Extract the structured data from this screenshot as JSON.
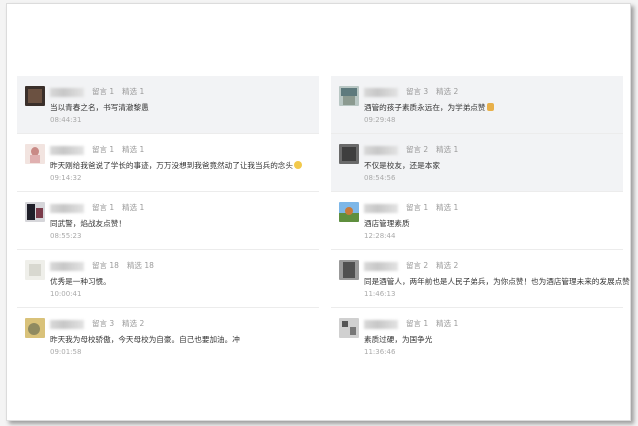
{
  "left": [
    {
      "likes": "留言 1",
      "picks": "精选 1",
      "text": "当以青春之名，书写清澈黎愚",
      "time": "08:44:31",
      "emoji": ""
    },
    {
      "likes": "留言 1",
      "picks": "精选 1",
      "text": "昨天刚给我爸说了学长的事迹，万万没想到我爸竟然动了让我当兵的念头",
      "time": "09:14:32",
      "emoji": "grin-emoji"
    },
    {
      "likes": "留言 1",
      "picks": "精选 1",
      "text": "同武警，焰战友点赞！",
      "time": "08:55:23",
      "emoji": ""
    },
    {
      "likes": "留言 18",
      "picks": "精选 18",
      "text": "优秀是一种习惯。",
      "time": "10:00:41",
      "emoji": ""
    },
    {
      "likes": "留言 3",
      "picks": "精选 2",
      "text": "昨天我为母校骄傲，今天母校为自豪。自己也要加油。冲",
      "time": "09:01:58",
      "emoji": ""
    }
  ],
  "right": [
    {
      "likes": "留言 3",
      "picks": "精选 2",
      "text": "酒管的孩子素质永远在，为学弟点赞",
      "time": "09:29:48",
      "emoji": "thumbs-up-emoji"
    },
    {
      "likes": "留言 2",
      "picks": "精选 1",
      "text": "不仅是校友，还是本家",
      "time": "08:54:56",
      "emoji": ""
    },
    {
      "likes": "留言 1",
      "picks": "精选 1",
      "text": "酒店管理素质",
      "time": "12:28:44",
      "emoji": ""
    },
    {
      "likes": "留言 2",
      "picks": "精选 2",
      "text": "同是酒管人，两年前也是人民子弟兵，为你点赞！也为酒店管理未来的发展点赞！",
      "time": "11:46:13",
      "emoji": "thumbs-up-emoji"
    },
    {
      "likes": "留言 1",
      "picks": "精选 1",
      "text": "素质过硬，为国争光",
      "time": "11:36:46",
      "emoji": ""
    }
  ]
}
